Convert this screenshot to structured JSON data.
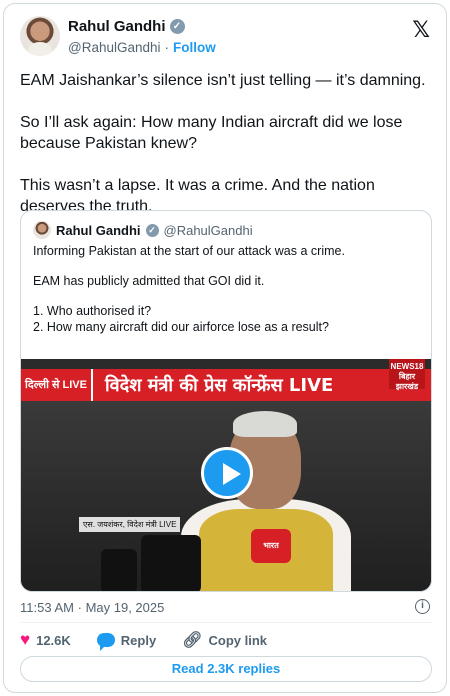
{
  "author": {
    "name": "Rahul Gandhi",
    "handle": "@RahulGandhi",
    "follow_label": "Follow",
    "separator": "·"
  },
  "tweet": {
    "paragraphs": [
      "EAM Jaishankar’s silence isn’t just telling — it’s damning.",
      "So I’ll ask again: How many Indian aircraft did we lose because Pakistan knew?",
      "This wasn’t a lapse. It was a crime. And the nation deserves the truth."
    ]
  },
  "quoted": {
    "name": "Rahul Gandhi",
    "handle": "@RahulGandhi",
    "lines": [
      "Informing Pakistan at the start of our attack was a crime.",
      "EAM has publicly admitted that GOI did it.",
      "1. Who authorised it?",
      "2. How many aircraft did our airforce lose as a result?"
    ],
    "video": {
      "banner_left": "दिल्ली से LIVE",
      "banner_main": "विदेश मंत्री की प्रेस कॉन्फ्रेंस LIVE",
      "channel_logo": "NEWS18 बिहार झारखंड",
      "caption": "एस. जयशंकर, विदेश मंत्री LIVE",
      "mic_logo": "भारत"
    }
  },
  "meta": {
    "time": "11:53 AM",
    "date": "May 19, 2025",
    "sep": "·"
  },
  "actions": {
    "likes": "12.6K",
    "reply_label": "Reply",
    "copy_label": "Copy link",
    "read_replies": "Read 2.3K replies"
  },
  "icons": {
    "logo": "x-logo",
    "verified": "verified-badge-icon",
    "like": "heart-icon",
    "reply": "reply-bubble-icon",
    "copy": "link-icon",
    "info": "info-icon",
    "play": "play-icon"
  },
  "colors": {
    "accent": "#1d9bf0",
    "like": "#f91880",
    "banner": "#d71f26"
  }
}
